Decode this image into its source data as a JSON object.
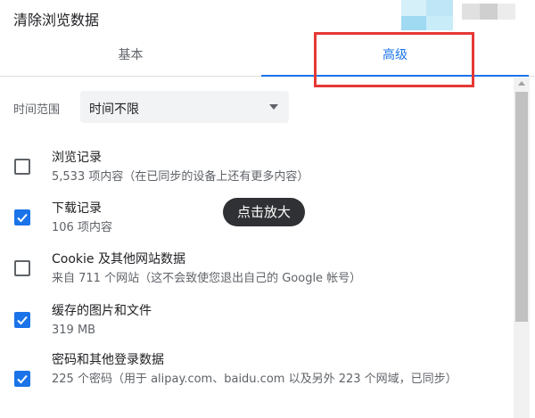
{
  "dialog": {
    "title": "清除浏览数据"
  },
  "tabs": [
    {
      "label": "基本",
      "active": false
    },
    {
      "label": "高级",
      "active": true
    }
  ],
  "time_range": {
    "label": "时间范围",
    "value": "时间不限"
  },
  "items": [
    {
      "title": "浏览记录",
      "subtitle": "5,533 项内容（在已同步的设备上还有更多内容）",
      "checked": false
    },
    {
      "title": "下载记录",
      "subtitle": "106 项内容",
      "checked": true
    },
    {
      "title": "Cookie 及其他网站数据",
      "subtitle": "来自 711 个网站（这不会致使您退出自己的 Google 帐号）",
      "checked": false
    },
    {
      "title": "缓存的图片和文件",
      "subtitle": "319 MB",
      "checked": true
    },
    {
      "title": "密码和其他登录数据",
      "subtitle": "225 个密码（用于 alipay.com、baidu.com 以及另外 223 个网域，已同步）",
      "checked": true
    }
  ],
  "tooltip": {
    "text": "点击放大"
  },
  "colors": {
    "accent": "#1a73e8",
    "highlight": "#e53935"
  }
}
